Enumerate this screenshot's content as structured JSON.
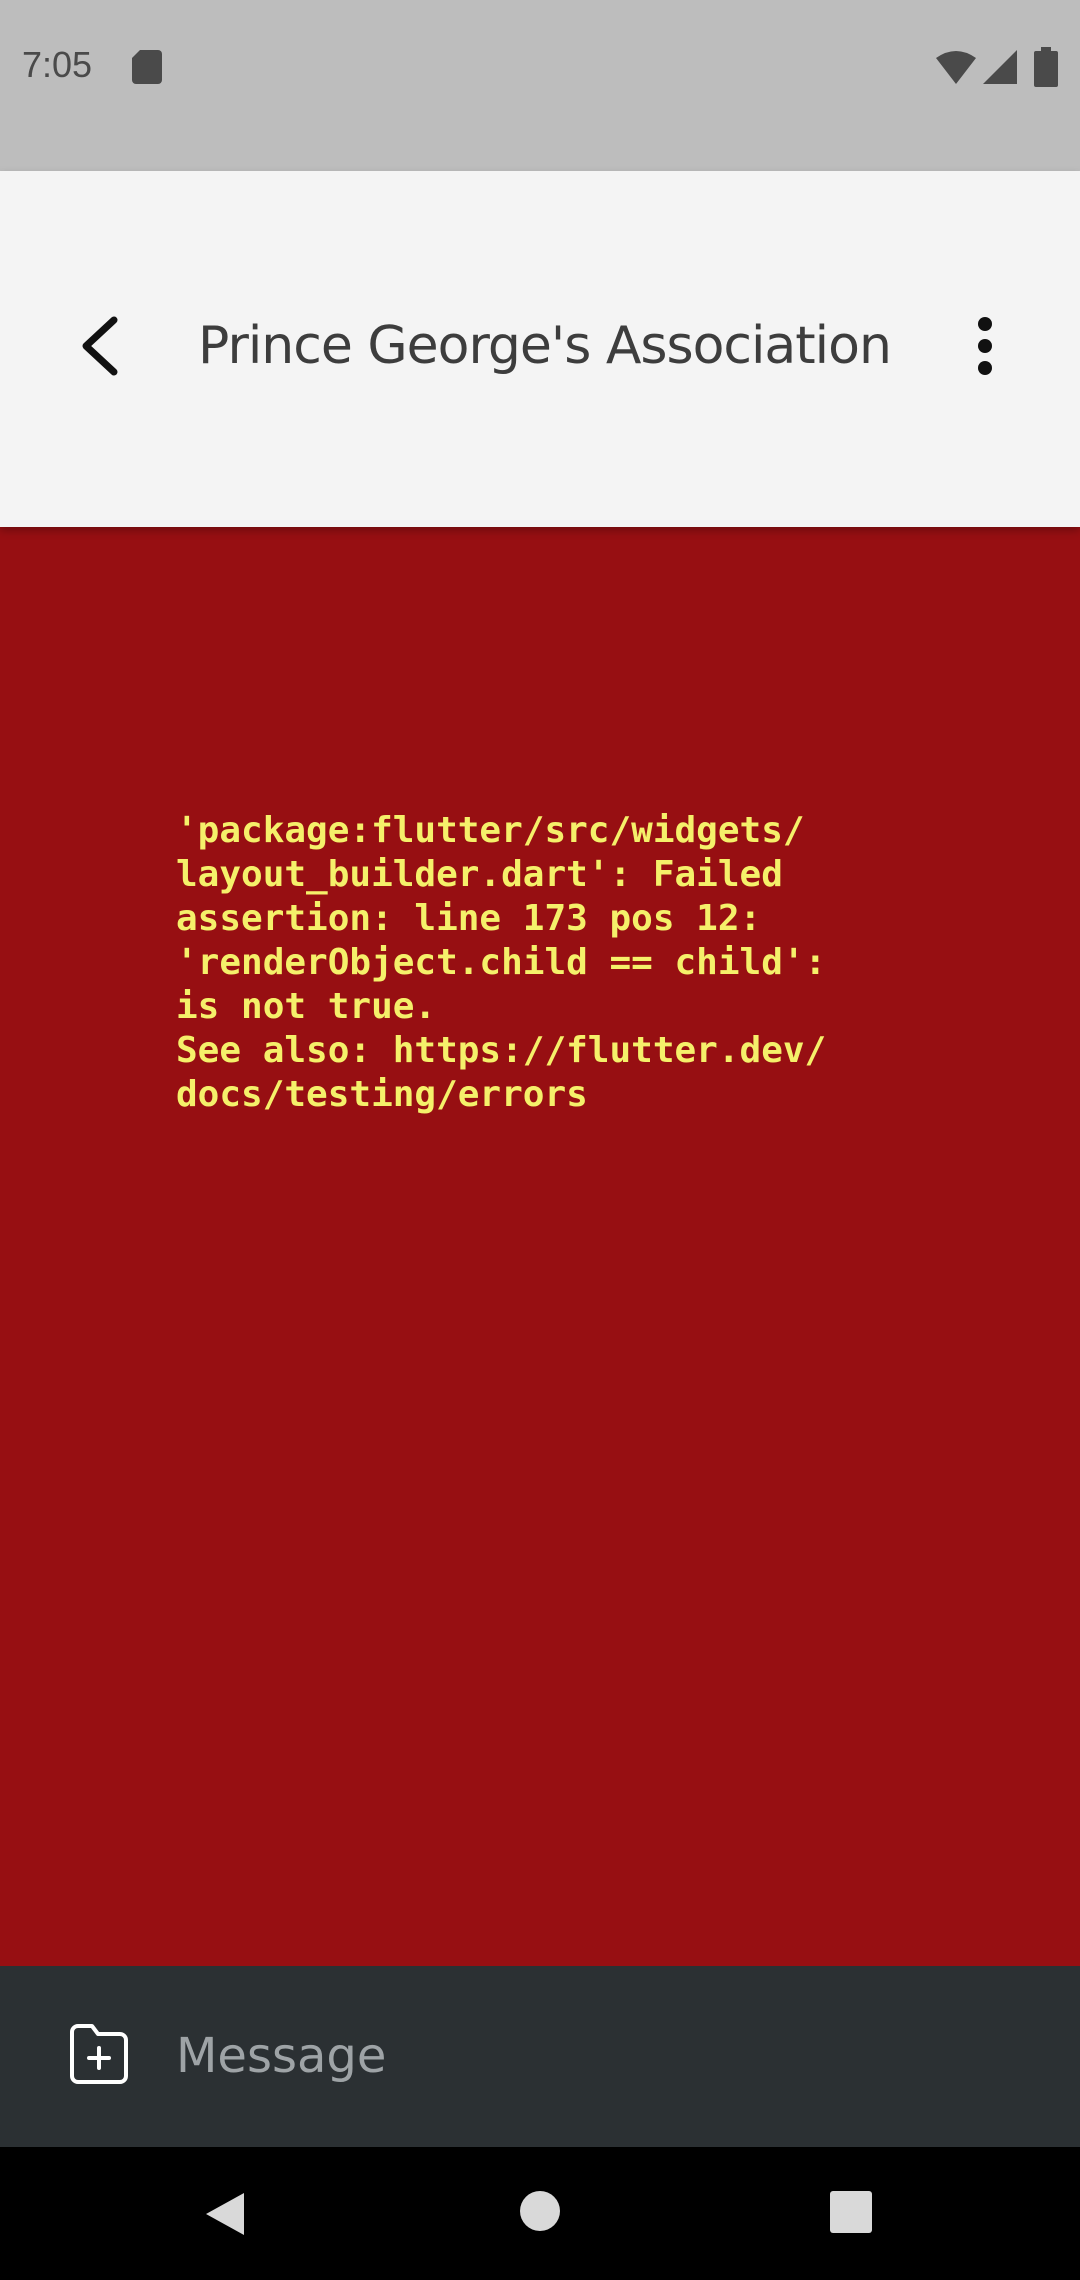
{
  "status_bar": {
    "time": "7:05",
    "icons": [
      "sd-card-icon",
      "wifi-icon",
      "signal-icon",
      "battery-icon"
    ]
  },
  "app_bar": {
    "title": "Prince George's Association",
    "back_icon": "chevron-left-icon",
    "menu_icon": "more-vert-icon"
  },
  "error": {
    "message": "'package:flutter/src/widgets/\nlayout_builder.dart': Failed\nassertion: line 173 pos 12:\n'renderObject.child == child':\nis not true.\nSee also: https://flutter.dev/\ndocs/testing/errors"
  },
  "composer": {
    "attach_icon": "add-file-icon",
    "placeholder": "Message"
  },
  "nav_bar": {
    "icons": [
      "nav-back-icon",
      "nav-home-icon",
      "nav-recents-icon"
    ]
  },
  "colors": {
    "status_bar_bg": "#bdbdbd",
    "app_bar_bg": "#f4f4f4",
    "error_bg": "#970f12",
    "error_text": "#f5f06a",
    "composer_bg": "#2b3033"
  }
}
